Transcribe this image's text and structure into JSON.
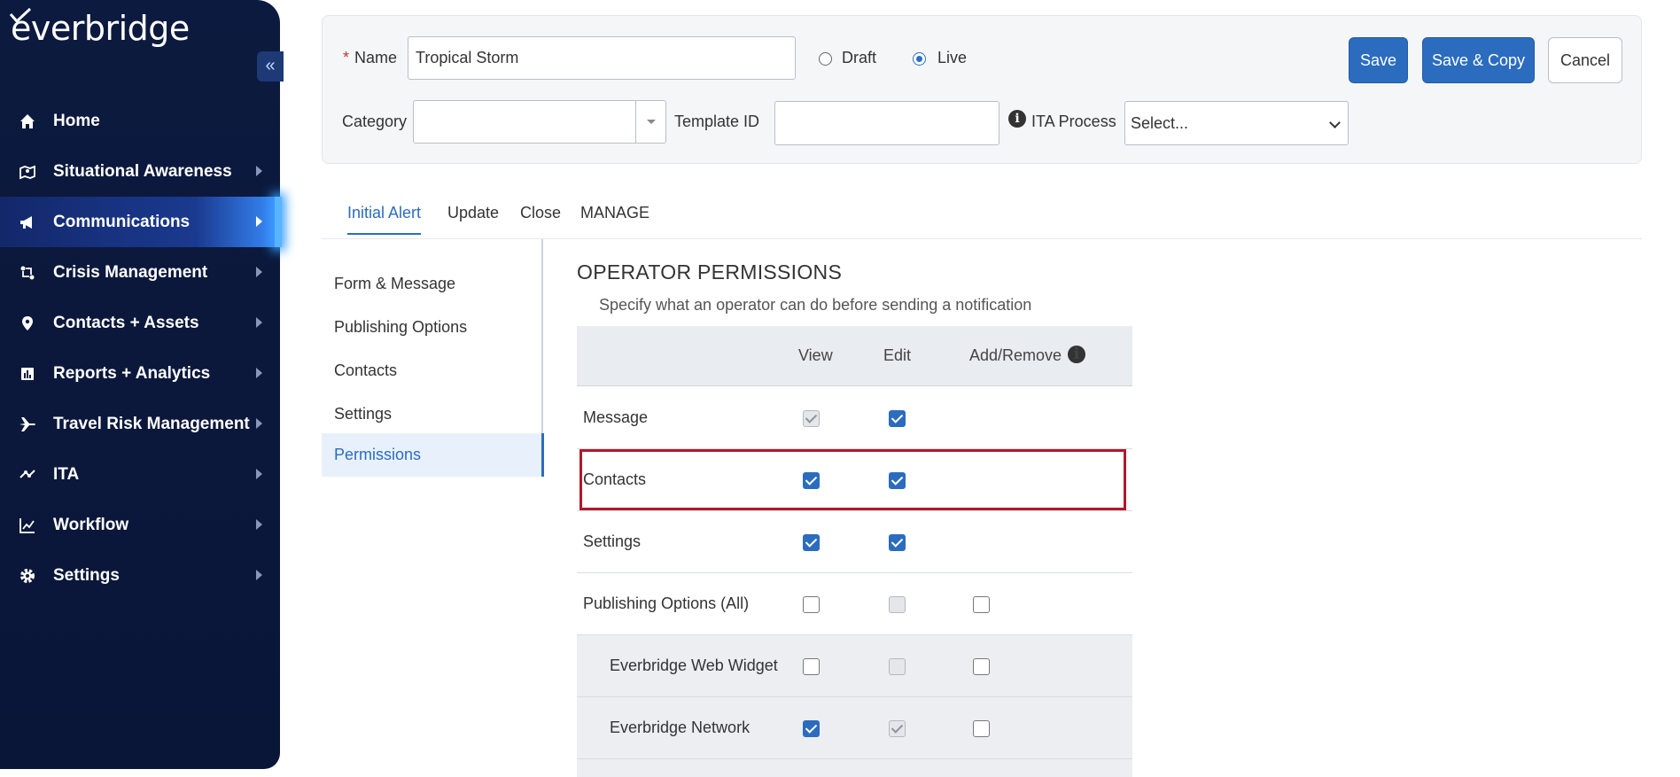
{
  "brand": {
    "logo_text": "everbridge"
  },
  "sidebar": {
    "collapse_label": "«",
    "items": [
      {
        "label": "Home",
        "icon": "home-icon",
        "active": false
      },
      {
        "label": "Situational Awareness",
        "icon": "map-icon",
        "active": false
      },
      {
        "label": "Communications",
        "icon": "megaphone-icon",
        "active": true
      },
      {
        "label": "Crisis Management",
        "icon": "crisis-icon",
        "active": false
      },
      {
        "label": "Contacts + Assets",
        "icon": "location-pin-icon",
        "active": false
      },
      {
        "label": "Reports + Analytics",
        "icon": "bar-chart-icon",
        "active": false
      },
      {
        "label": "Travel Risk Management",
        "icon": "plane-icon",
        "active": false
      },
      {
        "label": "ITA",
        "icon": "ita-icon",
        "active": false
      },
      {
        "label": "Workflow",
        "icon": "line-chart-icon",
        "active": false
      },
      {
        "label": "Settings",
        "icon": "gear-icon",
        "active": false
      }
    ]
  },
  "form": {
    "required_mark": "*",
    "name_label": "Name",
    "name_value": "Tropical Storm",
    "status_options": [
      "Draft",
      "Live"
    ],
    "status_selected": "Live",
    "category_label": "Category",
    "category_value": "",
    "template_id_label": "Template ID",
    "template_id_value": "",
    "ita_process_label": "ITA Process",
    "ita_process_value": "Select...",
    "info_glyph": "i"
  },
  "actions": {
    "save": "Save",
    "save_copy": "Save & Copy",
    "cancel": "Cancel"
  },
  "tabs": [
    {
      "label": "Initial Alert",
      "active": true
    },
    {
      "label": "Update",
      "active": false
    },
    {
      "label": "Close",
      "active": false
    },
    {
      "label": "MANAGE",
      "active": false
    }
  ],
  "submenu": [
    {
      "label": "Form & Message",
      "active": false
    },
    {
      "label": "Publishing Options",
      "active": false
    },
    {
      "label": "Contacts",
      "active": false
    },
    {
      "label": "Settings",
      "active": false
    },
    {
      "label": "Permissions",
      "active": true
    }
  ],
  "permissions": {
    "title": "OPERATOR PERMISSIONS",
    "subtitle": "Specify what an operator can do before sending a notification",
    "columns": [
      "View",
      "Edit",
      "Add/Remove"
    ],
    "rows": [
      {
        "label": "Message",
        "view": "checked-disabled",
        "edit": "checked",
        "add": "none"
      },
      {
        "label": "Contacts",
        "view": "checked",
        "edit": "checked",
        "add": "none",
        "highlighted": true
      },
      {
        "label": "Settings",
        "view": "checked",
        "edit": "checked",
        "add": "none"
      },
      {
        "label": "Publishing Options (All)",
        "view": "unchecked",
        "edit": "disabled",
        "add": "unchecked"
      },
      {
        "label": "Everbridge Web Widget",
        "view": "unchecked",
        "edit": "disabled",
        "add": "unchecked",
        "indent": true
      },
      {
        "label": "Everbridge Network",
        "view": "checked",
        "edit": "checked-disabled",
        "add": "unchecked",
        "indent": true
      }
    ]
  },
  "colors": {
    "sidebar_bg": "#0c1a3f",
    "accent": "#2b6cbf",
    "highlight_border": "#b2182b"
  }
}
